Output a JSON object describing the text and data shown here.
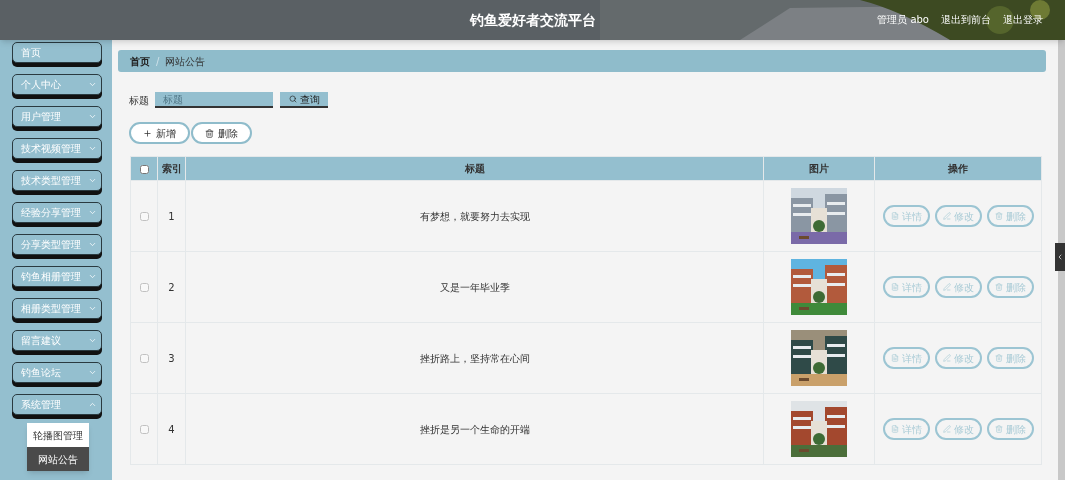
{
  "header": {
    "title": "钓鱼爱好者交流平台",
    "user": "管理员 abo",
    "links": [
      "退出到前台",
      "退出登录"
    ]
  },
  "sidebar": {
    "items": [
      {
        "label": "首页",
        "kind": "link"
      },
      {
        "label": "个人中心",
        "kind": "group",
        "expanded": false
      },
      {
        "label": "用户管理",
        "kind": "group",
        "expanded": false
      },
      {
        "label": "技术视频管理",
        "kind": "group",
        "expanded": false
      },
      {
        "label": "技术类型管理",
        "kind": "group",
        "expanded": false
      },
      {
        "label": "经验分享管理",
        "kind": "group",
        "expanded": false
      },
      {
        "label": "分享类型管理",
        "kind": "group",
        "expanded": false
      },
      {
        "label": "钓鱼相册管理",
        "kind": "group",
        "expanded": false
      },
      {
        "label": "相册类型管理",
        "kind": "group",
        "expanded": false
      },
      {
        "label": "留言建议",
        "kind": "group",
        "expanded": false
      },
      {
        "label": "钓鱼论坛",
        "kind": "group",
        "expanded": false
      },
      {
        "label": "系统管理",
        "kind": "group",
        "expanded": true,
        "children": [
          {
            "label": "轮播图管理",
            "selected": false
          },
          {
            "label": "网站公告",
            "selected": true
          }
        ]
      }
    ]
  },
  "breadcrumb": {
    "items": [
      "首页",
      "网站公告"
    ],
    "separator": "/"
  },
  "search": {
    "label": "标题",
    "placeholder": "标题",
    "button": "查询"
  },
  "toolbar": [
    "新增",
    "删除"
  ],
  "table": {
    "select_all": {
      "checked": false
    },
    "columns": [
      "索引",
      "标题",
      "图片",
      "操作"
    ],
    "rows": [
      {
        "checked": false,
        "index": "1",
        "title": "有梦想，就要努力去实现",
        "picture": {
          "kind": "picture"
        },
        "actions": [
          "详情",
          "修改",
          "删除"
        ]
      },
      {
        "checked": false,
        "index": "2",
        "title": "又是一年毕业季",
        "picture": {
          "kind": "picture"
        },
        "actions": [
          "详情",
          "修改",
          "删除"
        ]
      },
      {
        "checked": false,
        "index": "3",
        "title": "挫折路上，坚持常在心间",
        "picture": {
          "kind": "picture"
        },
        "actions": [
          "详情",
          "修改",
          "删除"
        ]
      },
      {
        "checked": false,
        "index": "4",
        "title": "挫折是另一个生命的开端",
        "picture": {
          "kind": "picture"
        },
        "actions": [
          "详情",
          "修改",
          "删除"
        ]
      }
    ]
  }
}
